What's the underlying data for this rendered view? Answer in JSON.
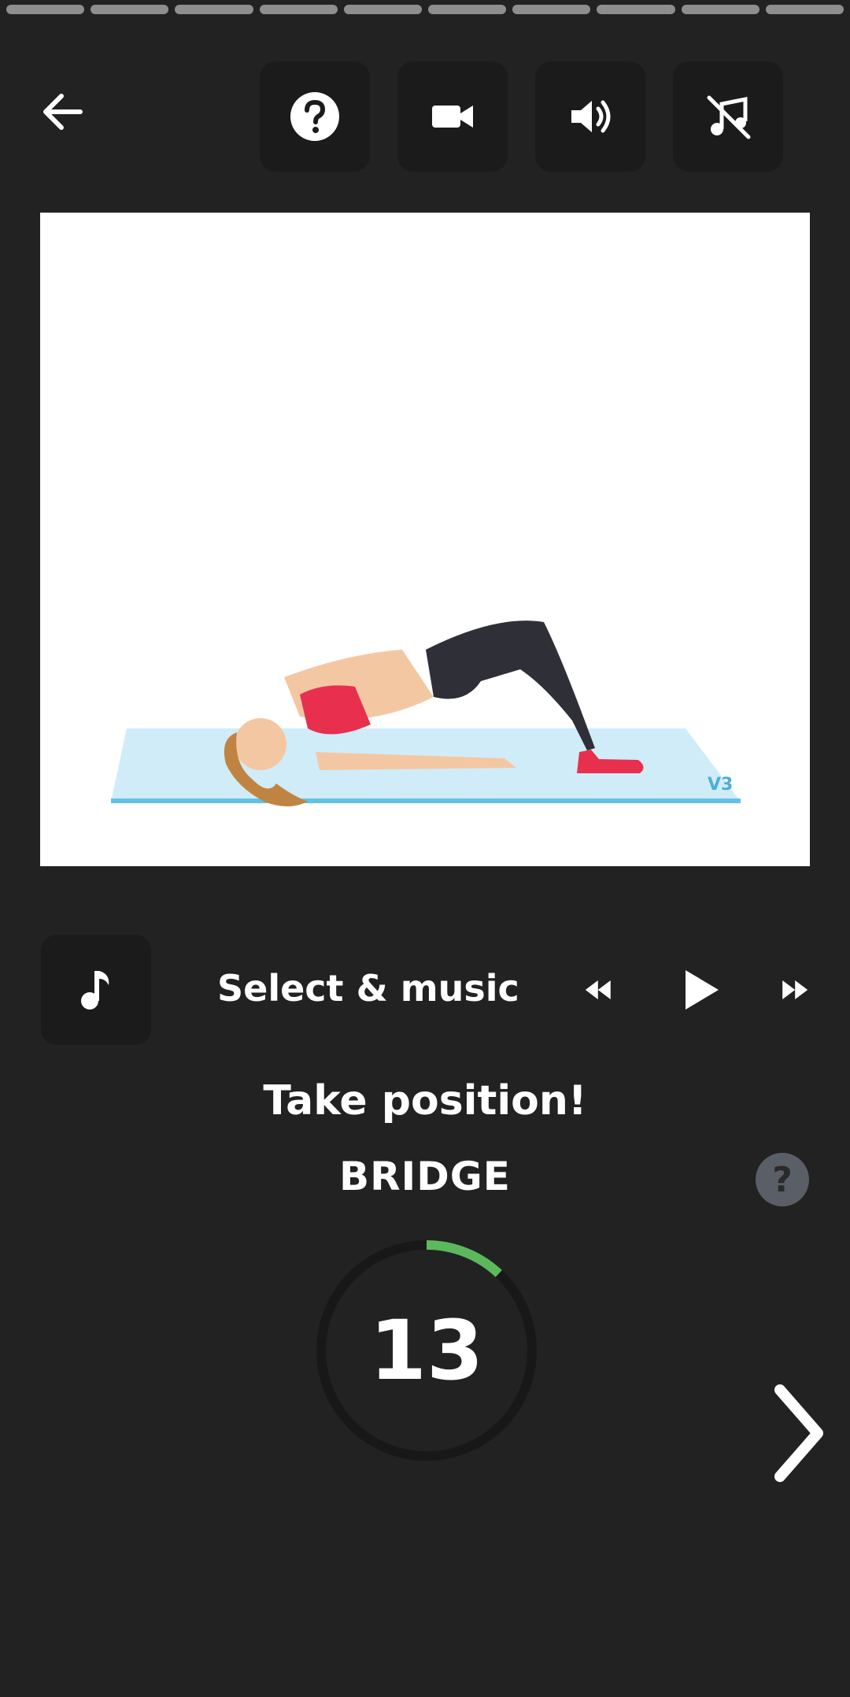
{
  "progress": {
    "segments": 10
  },
  "toolbar": {
    "icons": [
      "back-arrow-icon",
      "help-icon",
      "video-camera-icon",
      "volume-icon",
      "music-off-icon"
    ]
  },
  "music": {
    "label": "Select & music"
  },
  "exercise": {
    "status": "Take position!",
    "name": "BRIDGE",
    "info_label": "?"
  },
  "timer": {
    "value": "13",
    "progress": 0.12,
    "accent_color": "#5cb85c"
  },
  "colors": {
    "background": "#222222",
    "button_bg": "#1b1b1b"
  }
}
